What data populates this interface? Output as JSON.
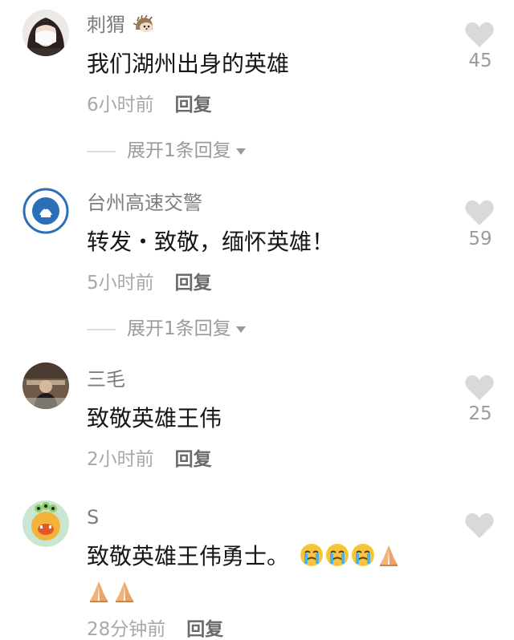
{
  "comments": [
    {
      "username": "刺猬",
      "text": "我们湖州出身的英雄",
      "time": "6小时前",
      "reply_label": "回复",
      "likes": "45",
      "expand_label": "展开1条回复",
      "avatar": "woman-with-mask-avatar",
      "username_icon": "hedgehog-icon"
    },
    {
      "username": "台州高速交警",
      "text": "转发・致敬，缅怀英雄！",
      "time": "5小时前",
      "reply_label": "回复",
      "likes": "59",
      "expand_label": "展开1条回复",
      "avatar": "traffic-police-badge-avatar",
      "badge_text": "台州高速交警"
    },
    {
      "username": "三毛",
      "text": "致敬英雄王伟",
      "time": "2小时前",
      "reply_label": "回复",
      "likes": "25",
      "avatar": "person-photo-avatar"
    },
    {
      "username": "S",
      "text": "致敬英雄王伟勇士。",
      "time": "28分钟前",
      "reply_label": "回复",
      "avatar": "cartoon-monster-avatar",
      "emojis_line1": [
        "crying-face-icon",
        "crying-face-icon",
        "crying-face-icon",
        "praying-hands-icon"
      ],
      "emojis_line2": [
        "praying-hands-icon",
        "praying-hands-icon"
      ]
    }
  ],
  "colors": {
    "heart": "#d9d9d9",
    "badge_blue": "#2a6fb8"
  }
}
